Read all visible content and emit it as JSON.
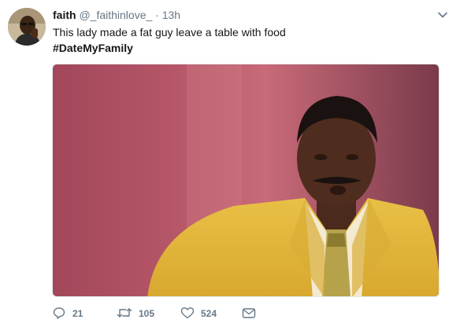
{
  "tweet": {
    "author_name": "faith",
    "author_handle": "@_faithinlove_",
    "separator": "·",
    "timestamp": "13h",
    "text_line1": "This lady made a fat guy leave a table with food",
    "hashtag": "#DateMyFamily",
    "media_alt": "Man in yellow suit making a shocked face"
  },
  "actions": {
    "reply_count": "21",
    "retweet_count": "105",
    "like_count": "524"
  },
  "icons": {
    "menu": "chevron-down-icon",
    "reply": "reply-icon",
    "retweet": "retweet-icon",
    "like": "heart-icon",
    "dm": "envelope-icon"
  },
  "colors": {
    "text": "#14171a",
    "muted": "#657786",
    "border": "#e1e8ed"
  }
}
